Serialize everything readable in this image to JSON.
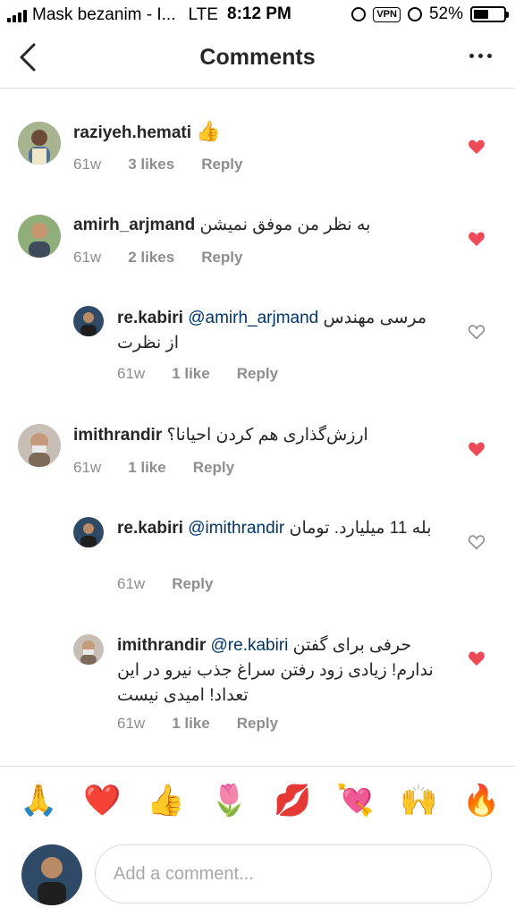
{
  "status_bar": {
    "carrier": "Mask bezanim - I...",
    "network": "LTE",
    "time": "8:12 PM",
    "vpn": "VPN",
    "battery": "52%"
  },
  "header": {
    "title": "Comments"
  },
  "comments": [
    {
      "username": "raziyeh.hemati",
      "text": "👍",
      "time": "61w",
      "likes": "3 likes",
      "reply": "Reply",
      "liked": true
    },
    {
      "username": "amirh_arjmand",
      "text": "به نظر من موفق نمیشن",
      "time": "61w",
      "likes": "2 likes",
      "reply": "Reply",
      "liked": true
    },
    {
      "username": "re.kabiri",
      "mention": "@amirh_arjmand",
      "text": "مرسی مهندس از نظرت",
      "time": "61w",
      "likes": "1 like",
      "reply": "Reply",
      "liked": false
    },
    {
      "username": "imithrandir",
      "text": "ارزش‌گذاری هم کردن احیانا؟",
      "time": "61w",
      "likes": "1 like",
      "reply": "Reply",
      "liked": true
    },
    {
      "username": "re.kabiri",
      "mention": "@imithrandir",
      "text": "بله 11 میلیارد. تومان",
      "time": "61w",
      "likes": "",
      "reply": "Reply",
      "liked": false
    },
    {
      "username": "imithrandir",
      "mention": "@re.kabiri",
      "text": "حرفی برای گفتن ندارم! زیادی زود رفتن سراغ جذب نیرو در این تعداد! امیدی نیست",
      "time": "61w",
      "likes": "1 like",
      "reply": "Reply",
      "liked": true
    }
  ],
  "emojis": [
    "🙏",
    "❤️",
    "👍",
    "🌷",
    "💋",
    "💘",
    "🙌",
    "🔥"
  ],
  "composer": {
    "placeholder": "Add a comment..."
  },
  "colors": {
    "heart_liked": "#ed4956",
    "heart_outline": "#8e8e8e",
    "mention": "#003569",
    "meta": "#8e8e8e"
  }
}
